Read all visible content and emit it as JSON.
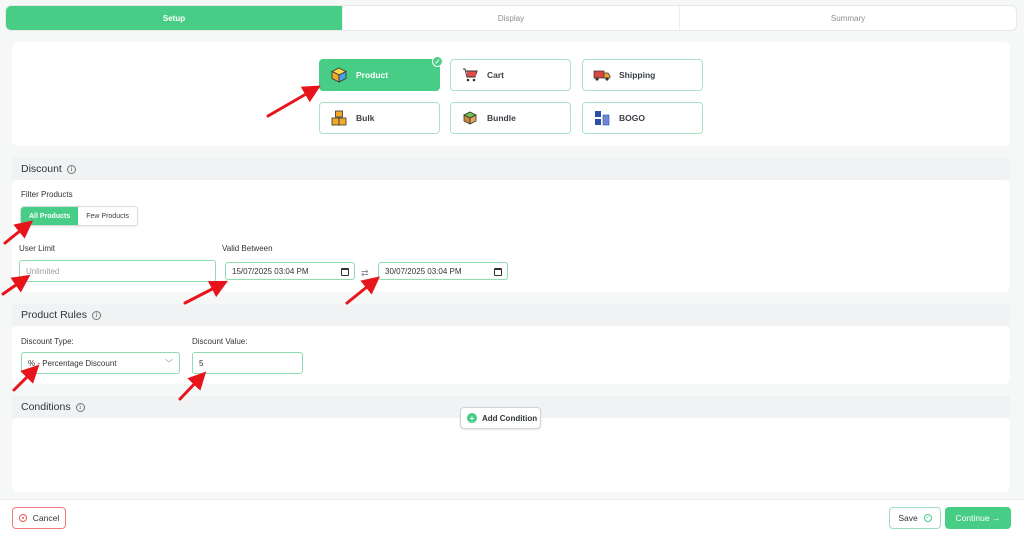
{
  "steps": [
    "Setup",
    "Display",
    "Summary"
  ],
  "types": [
    {
      "label": "Product",
      "icon": "box-icon",
      "selected": true
    },
    {
      "label": "Cart",
      "icon": "cart-icon"
    },
    {
      "label": "Shipping",
      "icon": "truck-icon"
    },
    {
      "label": "Bulk",
      "icon": "boxes-icon"
    },
    {
      "label": "Bundle",
      "icon": "bundle-icon"
    },
    {
      "label": "BOGO",
      "icon": "bogo-icon"
    }
  ],
  "discount": {
    "title": "Discount",
    "filter_label": "Filter Products",
    "filter_options": [
      "All Products",
      "Few Products"
    ],
    "user_limit_label": "User Limit",
    "user_limit_placeholder": "Unlimited",
    "valid_label": "Valid Between",
    "valid_from": "15/07/2025 03:04 PM",
    "valid_to": "30/07/2025 03:04 PM"
  },
  "rules": {
    "title": "Product Rules",
    "type_label": "Discount Type:",
    "type_value": "% - Percentage Discount",
    "value_label": "Discount Value:",
    "value": "5"
  },
  "conditions": {
    "title": "Conditions",
    "add_label": "Add Condition"
  },
  "footer": {
    "cancel": "Cancel",
    "save": "Save",
    "continue": "Continue →"
  },
  "colors": {
    "accent": "#48cd86",
    "arrow": "#e8141b",
    "danger": "#f07a7a"
  }
}
